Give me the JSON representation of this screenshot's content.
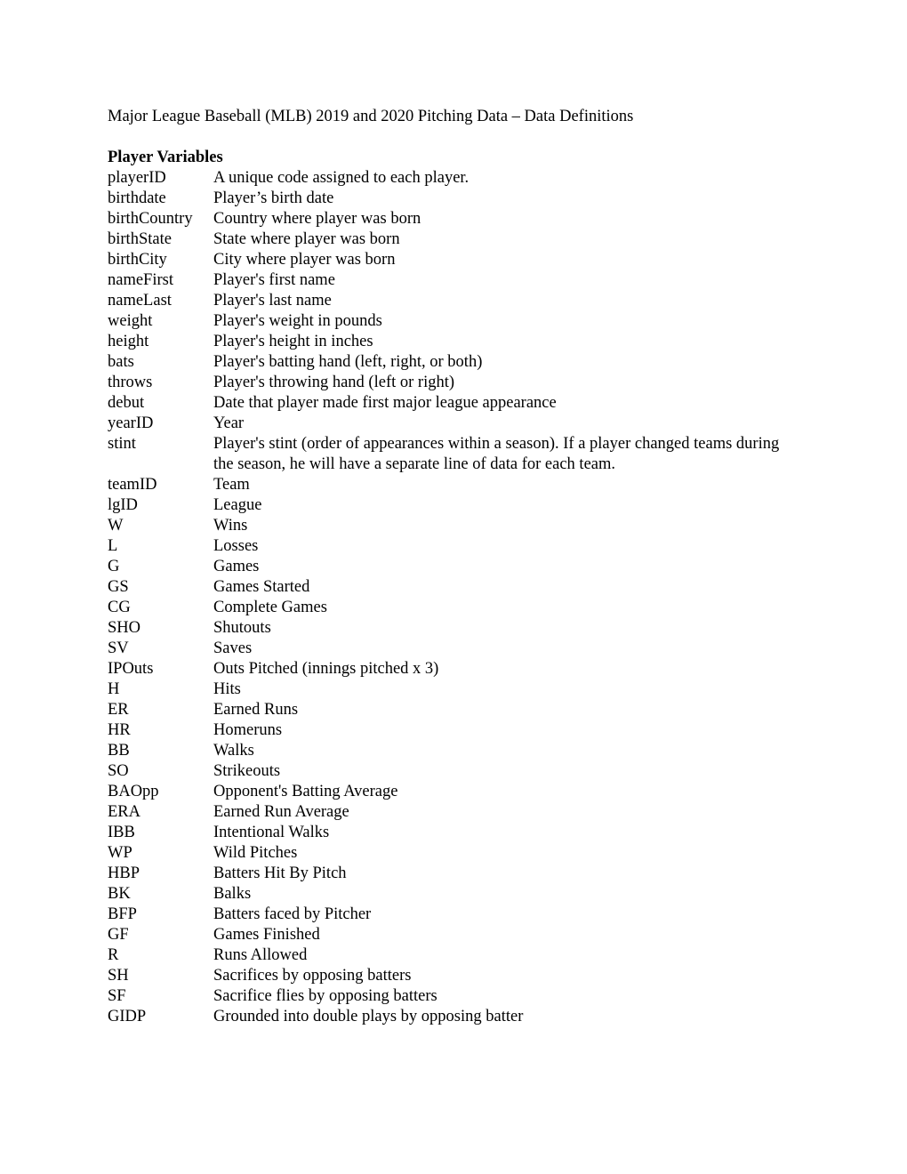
{
  "document": {
    "title": "Major League Baseball (MLB) 2019 and 2020 Pitching Data – Data Definitions",
    "section_heading": "Player Variables",
    "definitions": [
      {
        "term": "playerID",
        "description": "A unique code assigned to each player."
      },
      {
        "term": "birthdate",
        "description": "Player’s birth date"
      },
      {
        "term": "birthCountry",
        "description": "Country where player was born"
      },
      {
        "term": "birthState",
        "description": "State where player was born"
      },
      {
        "term": "birthCity",
        "description": "City where player was born"
      },
      {
        "term": "nameFirst",
        "description": "Player's first name"
      },
      {
        "term": "nameLast",
        "description": "Player's last name"
      },
      {
        "term": "weight",
        "description": "Player's weight in pounds"
      },
      {
        "term": "height",
        "description": "Player's height in inches"
      },
      {
        "term": "bats",
        "description": "Player's batting hand (left, right, or both)"
      },
      {
        "term": "throws",
        "description": "Player's throwing hand (left or right)"
      },
      {
        "term": "debut",
        "description": "Date that player made first major league appearance"
      },
      {
        "term": "yearID",
        "description": "Year"
      },
      {
        "term": "stint",
        "description": "Player's stint (order of appearances within a season).  If a player changed teams during the season, he will have a separate line of data for each team."
      },
      {
        "term": "teamID",
        "description": "Team"
      },
      {
        "term": "lgID",
        "description": "League"
      },
      {
        "term": "W",
        "description": "Wins"
      },
      {
        "term": "L",
        "description": "Losses"
      },
      {
        "term": "G",
        "description": "Games"
      },
      {
        "term": "GS",
        "description": "Games Started"
      },
      {
        "term": "CG",
        "description": "Complete Games"
      },
      {
        "term": "SHO",
        "description": "Shutouts"
      },
      {
        "term": "SV",
        "description": "Saves"
      },
      {
        "term": "IPOuts",
        "description": "Outs Pitched (innings pitched x 3)"
      },
      {
        "term": "H",
        "description": "Hits"
      },
      {
        "term": "ER",
        "description": "Earned Runs"
      },
      {
        "term": "HR",
        "description": "Homeruns"
      },
      {
        "term": "BB",
        "description": "Walks"
      },
      {
        "term": "SO",
        "description": "Strikeouts"
      },
      {
        "term": "BAOpp",
        "description": "Opponent's Batting Average"
      },
      {
        "term": "ERA",
        "description": "Earned Run Average"
      },
      {
        "term": "IBB",
        "description": "Intentional Walks"
      },
      {
        "term": "WP",
        "description": "Wild Pitches"
      },
      {
        "term": "HBP",
        "description": "Batters Hit By Pitch"
      },
      {
        "term": "BK",
        "description": "Balks"
      },
      {
        "term": "BFP",
        "description": "Batters faced by Pitcher"
      },
      {
        "term": "GF",
        "description": "Games Finished"
      },
      {
        "term": "R",
        "description": "Runs Allowed"
      },
      {
        "term": "SH",
        "description": "Sacrifices by opposing batters"
      },
      {
        "term": "SF",
        "description": "Sacrifice flies by opposing batters"
      },
      {
        "term": "GIDP",
        "description": "Grounded into double plays by opposing batter"
      }
    ]
  }
}
